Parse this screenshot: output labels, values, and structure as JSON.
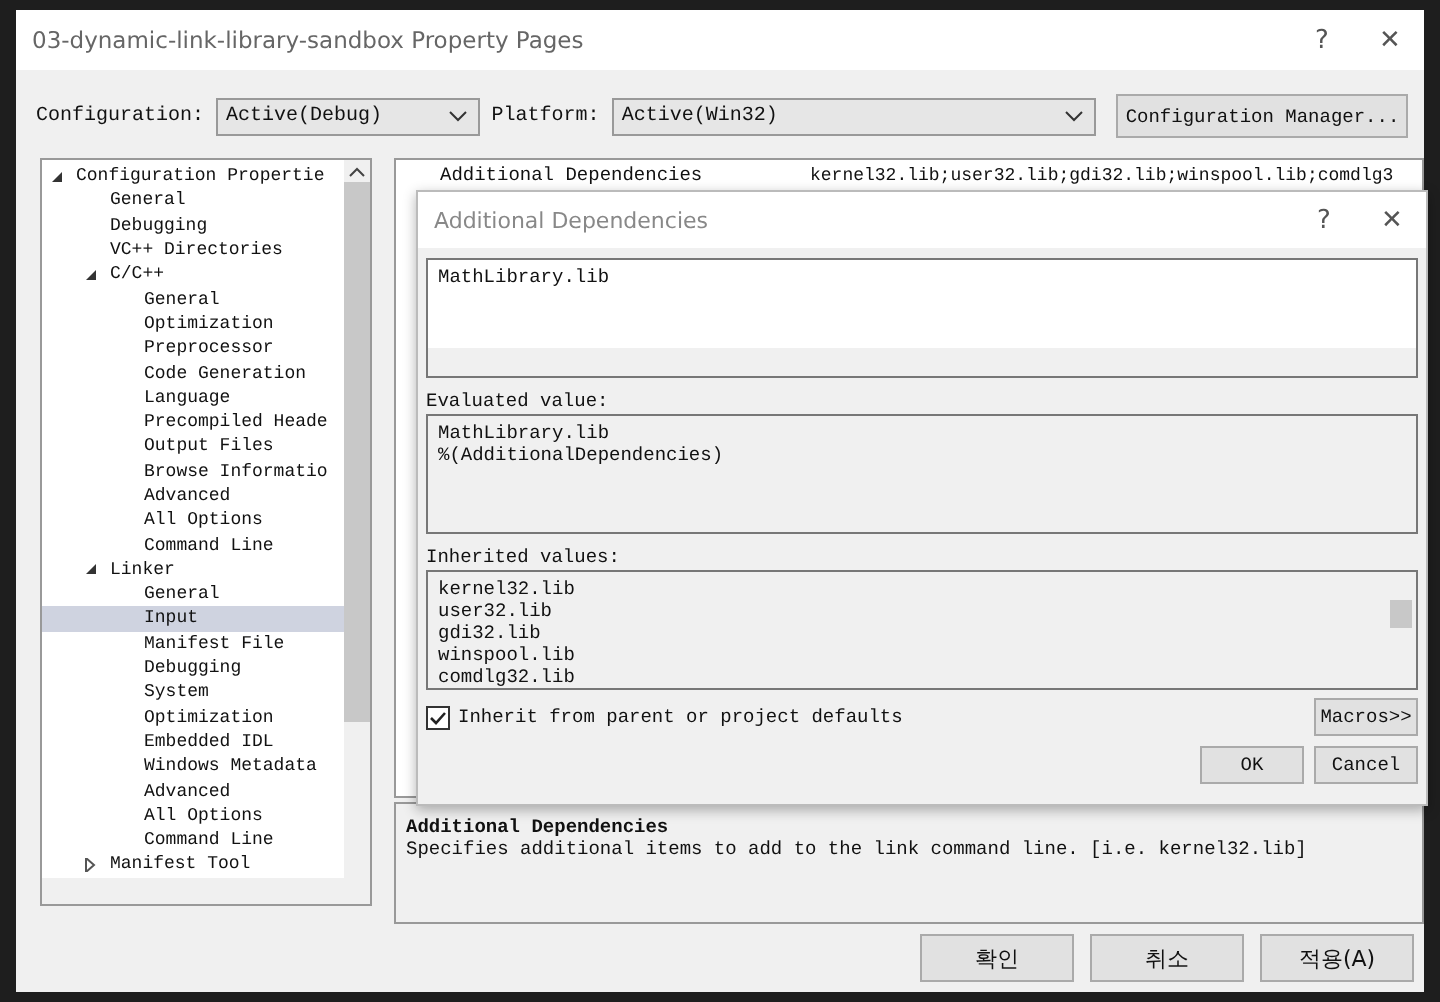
{
  "window": {
    "title": "03-dynamic-link-library-sandbox Property Pages",
    "help": "?",
    "close": "✕"
  },
  "toolbar": {
    "configuration_label": "Configuration:",
    "configuration": "Active(Debug)",
    "platform_label": "Platform:",
    "platform": "Active(Win32)",
    "manager_button": "Configuration Manager..."
  },
  "tree": [
    {
      "label": "Configuration Propertie",
      "expanded": true,
      "selected": false,
      "children": [
        {
          "label": "General",
          "selected": false
        },
        {
          "label": "Debugging",
          "selected": false
        },
        {
          "label": "VC++ Directories",
          "selected": false
        },
        {
          "label": "C/C++",
          "expanded": true,
          "selected": false,
          "children": [
            {
              "label": "General",
              "selected": false
            },
            {
              "label": "Optimization",
              "selected": false
            },
            {
              "label": "Preprocessor",
              "selected": false
            },
            {
              "label": "Code Generation",
              "selected": false
            },
            {
              "label": "Language",
              "selected": false
            },
            {
              "label": "Precompiled Heade",
              "selected": false
            },
            {
              "label": "Output Files",
              "selected": false
            },
            {
              "label": "Browse Informatio",
              "selected": false
            },
            {
              "label": "Advanced",
              "selected": false
            },
            {
              "label": "All Options",
              "selected": false
            },
            {
              "label": "Command Line",
              "selected": false
            }
          ]
        },
        {
          "label": "Linker",
          "expanded": true,
          "selected": false,
          "children": [
            {
              "label": "General",
              "selected": false
            },
            {
              "label": "Input",
              "selected": true
            },
            {
              "label": "Manifest File",
              "selected": false
            },
            {
              "label": "Debugging",
              "selected": false
            },
            {
              "label": "System",
              "selected": false
            },
            {
              "label": "Optimization",
              "selected": false
            },
            {
              "label": "Embedded IDL",
              "selected": false
            },
            {
              "label": "Windows Metadata",
              "selected": false
            },
            {
              "label": "Advanced",
              "selected": false
            },
            {
              "label": "All Options",
              "selected": false
            },
            {
              "label": "Command Line",
              "selected": false
            }
          ]
        },
        {
          "label": "Manifest Tool",
          "expanded": false,
          "selected": false
        }
      ]
    }
  ],
  "properties": [
    {
      "name": "Additional Dependencies",
      "value": "kernel32.lib;user32.lib;gdi32.lib;winspool.lib;comdlg3"
    }
  ],
  "description": {
    "title": "Additional Dependencies",
    "text": "Specifies additional items to add to the link command line. [i.e. kernel32.lib]"
  },
  "buttons": [
    "확인",
    "취소",
    "적용(A)"
  ],
  "dialog": {
    "title": "Additional Dependencies",
    "help": "?",
    "close": "✕",
    "value_lines": [
      "MathLibrary.lib"
    ],
    "evaluated_label": "Evaluated value:",
    "evaluated_lines": [
      "MathLibrary.lib",
      "%(AdditionalDependencies)"
    ],
    "inherited_label": "Inherited values:",
    "inherited_lines": [
      "kernel32.lib",
      "user32.lib",
      "gdi32.lib",
      "winspool.lib",
      "comdlg32.lib"
    ],
    "inherit_checkbox": {
      "label": "Inherit from parent or project defaults",
      "checked": true
    },
    "macros_button": "Macros>>",
    "ok_button": "OK",
    "cancel_button": "Cancel"
  }
}
